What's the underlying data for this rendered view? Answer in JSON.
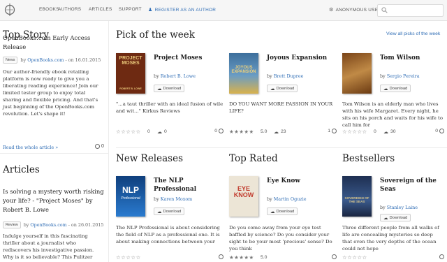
{
  "nav": {
    "items": [
      "EBOOKS",
      "AUTHORS",
      "ARTICLES",
      "SUPPORT"
    ],
    "register": "REGISTER AS AN AUTHOR",
    "user": "ANONYMOUS USER",
    "search_placeholder": "",
    "accent": "#2f6db5"
  },
  "top_story": {
    "heading": "Top Story",
    "title": "OpenBooks.com Early Access Release",
    "tag": "News",
    "by": "by",
    "author": "OpenBooks.com",
    "date": "- on 16.01.2015",
    "body": "Our author-friendly ebook retailing platform is now ready to give you a liberating reading experience! Join our limited tester group to enjoy total sharing and flexible pricing. And that's just beginning of the OpenBooks.com revolution. Let's shape it!",
    "read_more": "Read the whole article »",
    "comments": "0"
  },
  "articles": {
    "heading": "Articles",
    "title": "Is solving a mystery worth risking your life? - \"Project Moses\" by Robert B. Lowe",
    "tag": "Review",
    "by": "by",
    "author": "OpenBooks.com",
    "date": "- on 26.01.2015",
    "body": "Indulge yourself in this fascinating thriller about a journalist who rediscovers his investigative passion. Why is it so believable? This Pulitzer Prize winning author has been"
  },
  "sections": {
    "pick": "Pick of the week",
    "view_all": "View all picks of the week",
    "new": "New Releases",
    "top": "Top Rated",
    "best": "Bestsellers"
  },
  "download_label": "Download",
  "books": [
    {
      "title": "Project Moses",
      "by": "by",
      "author": "Robert B. Lowe",
      "desc": "\"...a taut thriller with an ideal fusion of wile and wit...\" Kirkus Reviews",
      "rating": "0",
      "downloads": "0",
      "comments": "0",
      "cover_text": "PROJECT MOSES",
      "cover_sub": "ROBERT B. LOWE",
      "cover_bg": "#6e2a12",
      "cover_fg": "#e9c77a"
    },
    {
      "title": "Joyous Expansion",
      "by": "by",
      "author": "Brett Dupree",
      "desc": "DO YOU WANT MORE PASSION IN YOUR LIFE?",
      "rating": "5.0",
      "downloads": "23",
      "comments": "1",
      "cover_text": "JOYOUS EXPANSION",
      "cover_sub": "",
      "cover_bg": "#3d6f9c",
      "cover_fg": "#f1d27a"
    },
    {
      "title": "Tom Wilson",
      "by": "by",
      "author": "Sergio Pereira",
      "desc": "Tom Wilson is an elderly man who lives with his wife Margaret. Every night, he sits on his porch and waits for his wife to call him for",
      "rating": "0",
      "downloads": "30",
      "comments": "0",
      "cover_text": "",
      "cover_sub": "",
      "cover_bg": "#a66a2c",
      "cover_fg": "#f5e0b0"
    },
    {
      "title": "The NLP Professional",
      "by": "by",
      "author": "Karen Moxom",
      "desc": "The NLP Professional is about considering the field of NLP as a professional one. It is about making connections between your",
      "rating": "",
      "downloads": "",
      "comments": "",
      "cover_text": "NLP",
      "cover_sub": "Professional",
      "cover_bg": "#1f5fa8",
      "cover_fg": "#ffffff"
    },
    {
      "title": "Eye Know",
      "by": "by",
      "author": "Martin Oguzie",
      "desc": "Do you come away from your eye test baffled by science? Do you consider your sight to be your most 'precious' sense? Do you think",
      "rating": "5.0",
      "downloads": "",
      "comments": "",
      "cover_text": "EYE KNOW",
      "cover_sub": "",
      "cover_bg": "#e9e2d4",
      "cover_fg": "#c0392b"
    },
    {
      "title": "Sovereign of the Seas",
      "by": "by",
      "author": "Stanley Laine",
      "desc": "Three different people from all walks of life are concealing mysteries so deep that even the very depths of the ocean could not hope",
      "rating": "",
      "downloads": "",
      "comments": "",
      "cover_text": "SOVEREIGN OF THE SEAS",
      "cover_sub": "",
      "cover_bg": "#2a3f66",
      "cover_fg": "#d9c58a"
    }
  ]
}
